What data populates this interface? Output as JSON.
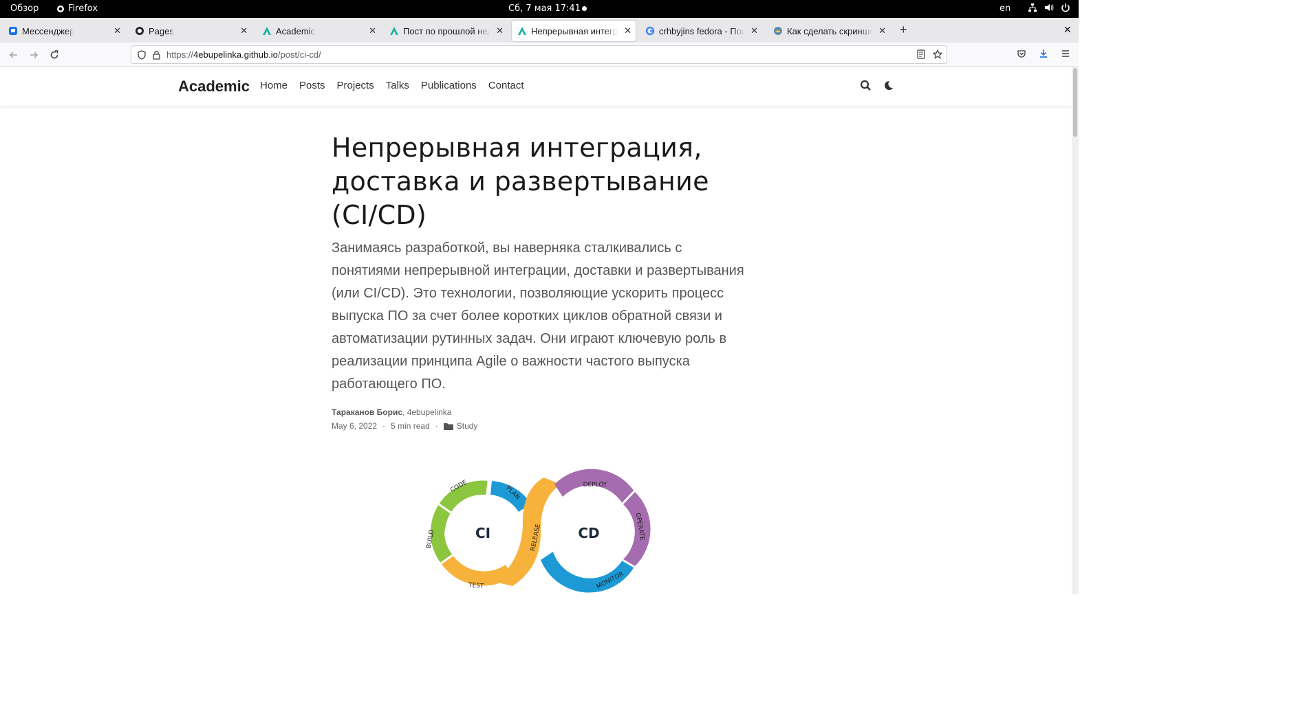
{
  "system": {
    "overview": "Обзор",
    "app_name": "Firefox",
    "clock": "Сб, 7 мая  17:41",
    "lang": "en"
  },
  "tabs": [
    {
      "title": "Мессенджер",
      "icon": "messenger-icon",
      "active": false
    },
    {
      "title": "Pages",
      "icon": "github-icon",
      "active": false
    },
    {
      "title": "Academic",
      "icon": "academic-icon",
      "active": false
    },
    {
      "title": "Пост по прошлой неделе",
      "icon": "academic-icon",
      "active": false
    },
    {
      "title": "Непрерывная интеграция",
      "icon": "academic-icon",
      "active": true
    },
    {
      "title": "crhbyjins fedora - Поиск в Google",
      "icon": "google-icon",
      "active": false
    },
    {
      "title": "Как сделать скриншот экрана",
      "icon": "page-icon",
      "active": false
    }
  ],
  "urlbar": {
    "prefix": "https://",
    "host": "4ebupelinka.github.io",
    "path": "/post/ci-cd/"
  },
  "site": {
    "brand": "Academic",
    "menu": [
      "Home",
      "Posts",
      "Projects",
      "Talks",
      "Publications",
      "Contact"
    ]
  },
  "article": {
    "title": "Непрерывная интеграция, доставка и развертывание (CI/CD)",
    "summary": "Занимаясь разработкой, вы наверняка сталкивались с понятиями непрерывной интеграции, доставки и развертывания (или CI/CD). Это технологии, позволяющие ускорить процесс выпуска ПО за счет более коротких циклов обратной связи и автоматизации рутинных задач. Они играют ключевую роль в реализации принципа Agile о важности частого выпуска работающего ПО.",
    "author": "Тараканов Борис",
    "author_alias": "4ebupelinka",
    "date": "May 6, 2022",
    "read_time": "5 min read",
    "category": "Study"
  },
  "diagram": {
    "left_label": "CI",
    "right_label": "CD",
    "segments": [
      "CODE",
      "PLAN",
      "BUILD",
      "TEST",
      "RELEASE",
      "DEPLOY",
      "OPERATE",
      "MONITOR"
    ]
  },
  "colors": {
    "green": "#8cc63f",
    "blue": "#1d9ad6",
    "orange": "#f7b23b",
    "purple": "#a66cb0"
  }
}
